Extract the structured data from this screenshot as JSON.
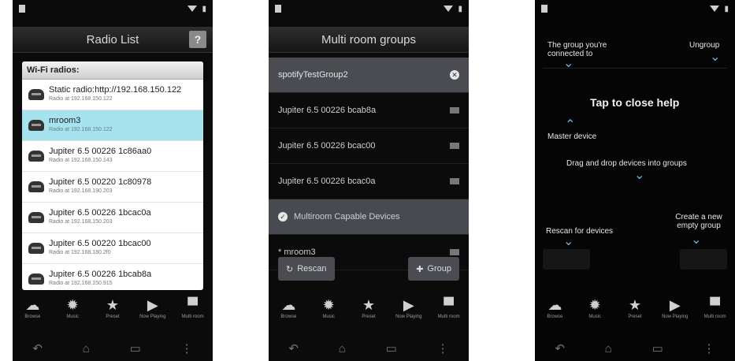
{
  "phone1": {
    "title": "Radio List",
    "help_label": "?",
    "list_header": "Wi-Fi radios:",
    "radios": [
      {
        "name": "Static radio:http://192.168.150.122",
        "sub": "Radio at 192.168.150.122"
      },
      {
        "name": "mroom3",
        "sub": "Radio at 192.168.150.122"
      },
      {
        "name": "Jupiter 6.5 00226 1c86aa0",
        "sub": "Radio at 192.168.150.143"
      },
      {
        "name": "Jupiter 6.5 00220 1c80978",
        "sub": "Radio at 192.168.190.203"
      },
      {
        "name": "Jupiter 6.5 00226 1bcac0a",
        "sub": "Radio at 192.168.150.203"
      },
      {
        "name": "Jupiter 6.5 00220 1bcac00",
        "sub": "Radio at 192.168.180.2f0"
      },
      {
        "name": "Jupiter 6.5 00226 1bcab8a",
        "sub": "Radio at 192.168.150.915"
      }
    ]
  },
  "phone2": {
    "title": "Multi room groups",
    "group_header": "spotifyTestGroup2",
    "devices": [
      "Jupiter 6.5 00226 bcab8a",
      "Jupiter 6.5 00226 bcac00",
      "Jupiter 6.5 00226 bcac0a"
    ],
    "capable_label": "Multiroom Capable Devices",
    "capable_item": "* mroom3",
    "rescan_label": "Rescan",
    "group_label": "Group"
  },
  "phone3": {
    "help_group": "The group you're connected to",
    "help_ungroup": "Ungroup",
    "help_close": "Tap to close help",
    "help_master": "Master device",
    "help_drag": "Drag and drop devices into groups",
    "help_rescan": "Rescan for devices",
    "help_create": "Create a new empty group"
  },
  "nav": [
    {
      "icon": "browse",
      "label": "Browse"
    },
    {
      "icon": "music",
      "label": "Music"
    },
    {
      "icon": "preset",
      "label": "Preset"
    },
    {
      "icon": "now-playing",
      "label": "Now Playing"
    },
    {
      "icon": "multi-room",
      "label": "Multi room"
    }
  ]
}
